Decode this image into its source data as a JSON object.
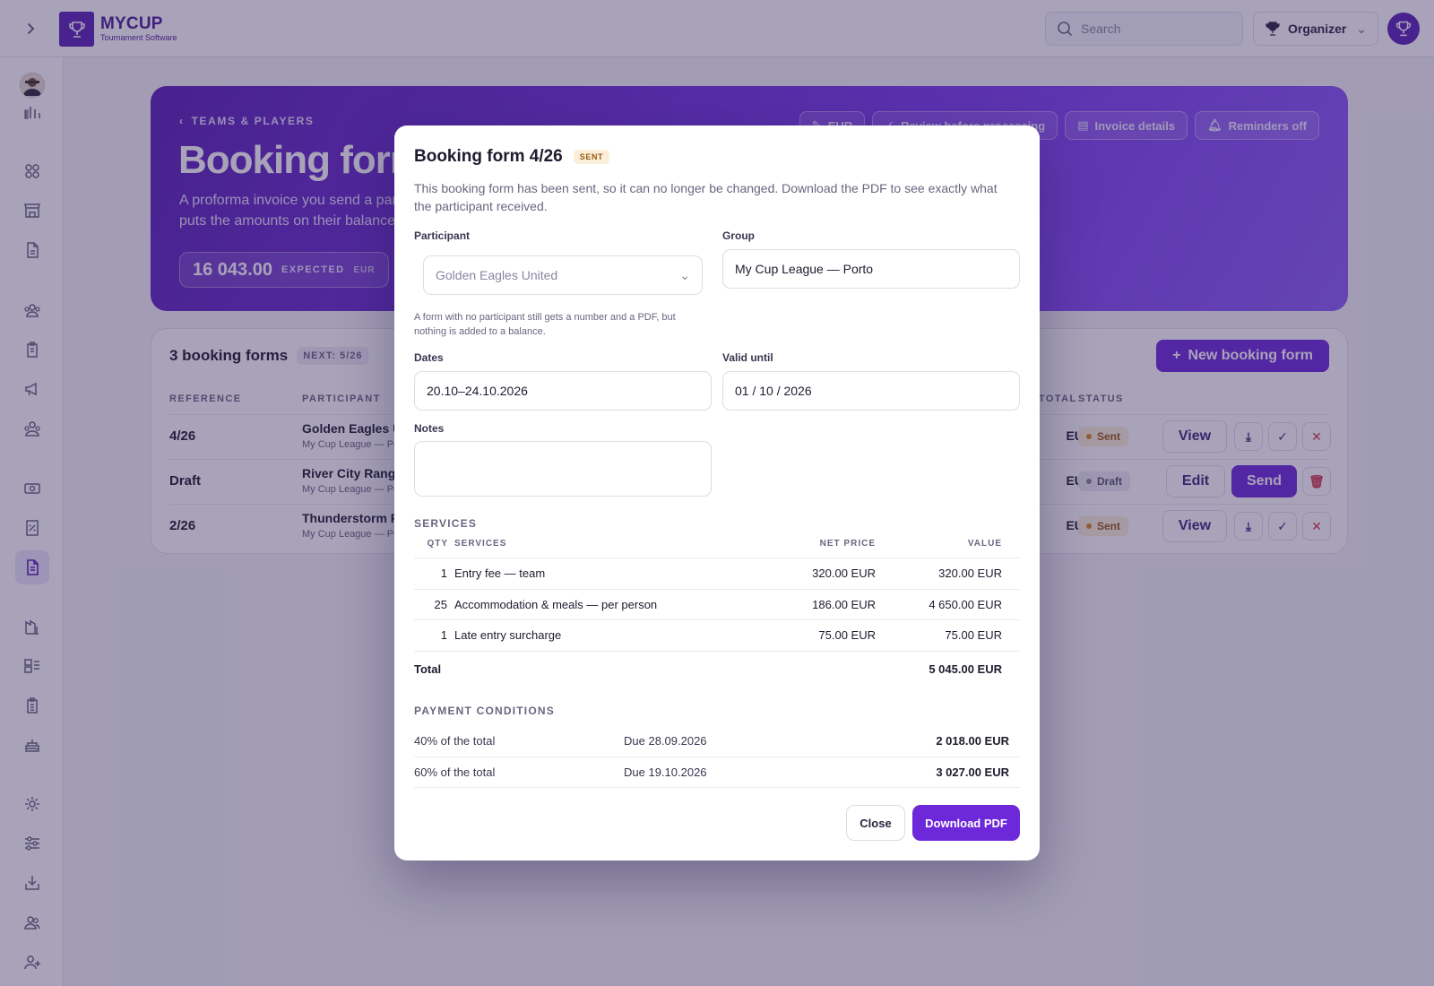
{
  "app": {
    "logo_name": "MYCUP",
    "logo_sub": "Tournament Software",
    "search_placeholder": "Search",
    "role_label": "Organizer"
  },
  "hero": {
    "breadcrumb": "TEAMS & PLAYERS",
    "title": "Booking forms",
    "description": "A proforma invoice you send a participant before you bill them. Once sent, it puts the amounts on their balance.",
    "stat_value": "16 043.00",
    "stat_label": "EXPECTED",
    "stat_currency": "EUR",
    "chips": [
      "EUR",
      "Review before processing",
      "Invoice details",
      "Reminders off"
    ]
  },
  "list": {
    "title": "3 booking forms",
    "next_badge": "NEXT: 5/26",
    "new_button": "New booking form",
    "headers": {
      "reference": "REFERENCE",
      "participant": "PARTICIPANT",
      "total": "TOTAL",
      "status": "STATUS"
    },
    "rows": [
      {
        "ref": "4/26",
        "participant": "Golden Eagles United",
        "group": "My Cup League — Porto",
        "total": "EUR",
        "status": "Sent",
        "primary": "View"
      },
      {
        "ref": "Draft",
        "participant": "River City Rangers",
        "group": "My Cup League — Porto",
        "total": "EUR",
        "status": "Draft",
        "primary": "Edit",
        "secondary": "Send"
      },
      {
        "ref": "2/26",
        "participant": "Thunderstorm FC",
        "group": "My Cup League — Porto",
        "total": "EUR",
        "status": "Sent",
        "primary": "View"
      }
    ]
  },
  "modal": {
    "title": "Booking form 4/26",
    "badge": "SENT",
    "description": "This booking form has been sent, so it can no longer be changed. Download the PDF to see exactly what the participant received.",
    "participant_label": "Participant",
    "participant_value": "Golden Eagles United",
    "participant_hint": "A form with no participant still gets a number and a PDF, but nothing is added to a balance.",
    "group_label": "Group",
    "group_value": "My Cup League — Porto",
    "dates_label": "Dates",
    "dates_value": "20.10–24.10.2026",
    "valid_label": "Valid until",
    "valid_value": "01 / 10 / 2026",
    "notes_label": "Notes",
    "services_title": "SERVICES",
    "services_headers": {
      "qty": "QTY",
      "services": "SERVICES",
      "net": "NET PRICE",
      "value": "VALUE"
    },
    "services": [
      {
        "qty": "1",
        "name": "Entry fee — team",
        "net": "320.00 EUR",
        "value": "320.00 EUR"
      },
      {
        "qty": "25",
        "name": "Accommodation & meals — per person",
        "net": "186.00 EUR",
        "value": "4 650.00 EUR"
      },
      {
        "qty": "1",
        "name": "Late entry surcharge",
        "net": "75.00 EUR",
        "value": "75.00 EUR"
      }
    ],
    "total_label": "Total",
    "total_value": "5 045.00 EUR",
    "payment_title": "PAYMENT CONDITIONS",
    "payments": [
      {
        "share": "40% of the total",
        "due": "Due 28.09.2026",
        "amount": "2 018.00 EUR"
      },
      {
        "share": "60% of the total",
        "due": "Due 19.10.2026",
        "amount": "3 027.00 EUR"
      }
    ],
    "close_button": "Close",
    "download_button": "Download PDF"
  }
}
